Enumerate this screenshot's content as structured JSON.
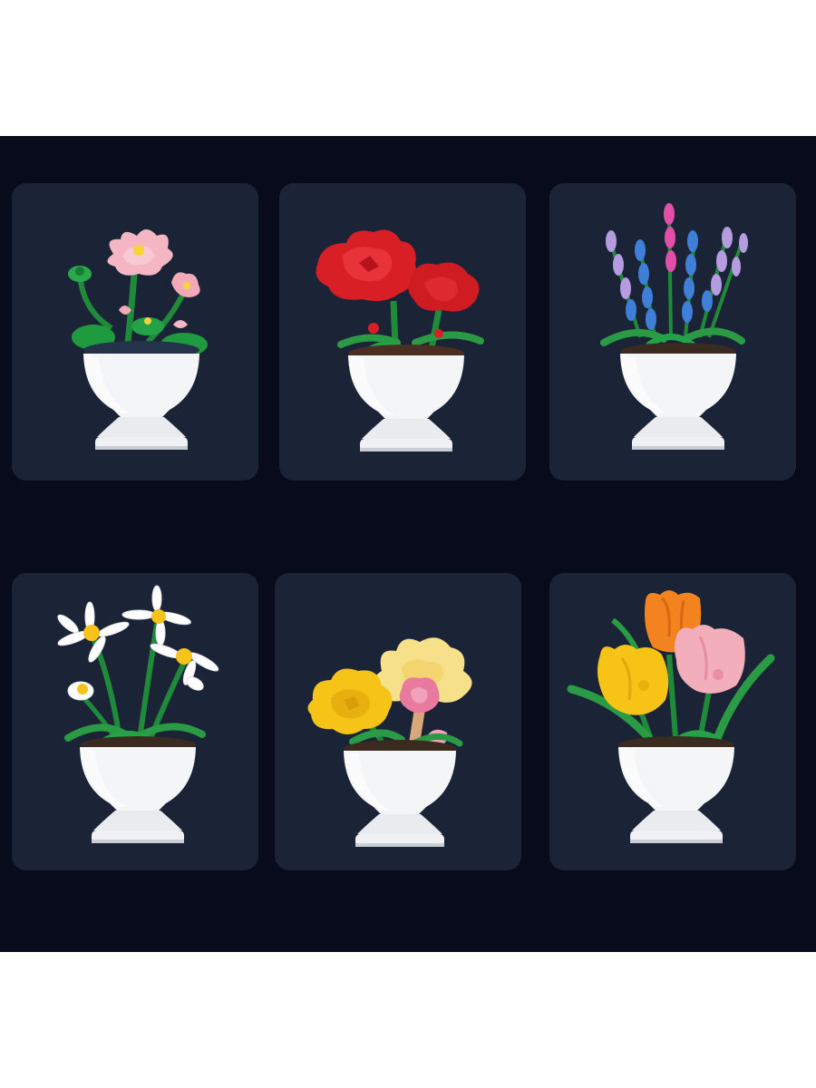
{
  "colors": {
    "page_background": "#ffffff",
    "panel_background": "#070b1c",
    "card_background": "#1b2436",
    "vase_white": "#f4f5f7",
    "leaf_green": "#1f8a3a"
  },
  "products": [
    {
      "flower": "lotus",
      "colors": [
        "#f4b6c2",
        "#f7d23a",
        "#2a9a44"
      ]
    },
    {
      "flower": "red-rose",
      "colors": [
        "#d81f26",
        "#b5121b",
        "#2a9a44"
      ]
    },
    {
      "flower": "lavender",
      "colors": [
        "#b59be0",
        "#3f7fd8",
        "#e24fa8"
      ]
    },
    {
      "flower": "daisy",
      "colors": [
        "#ffffff",
        "#f7c21a",
        "#2a9a44"
      ]
    },
    {
      "flower": "ranunculus",
      "colors": [
        "#f5c416",
        "#f7e08a",
        "#e87aa0"
      ]
    },
    {
      "flower": "tulip",
      "colors": [
        "#f6c316",
        "#f3831f",
        "#f2aebb"
      ]
    }
  ]
}
